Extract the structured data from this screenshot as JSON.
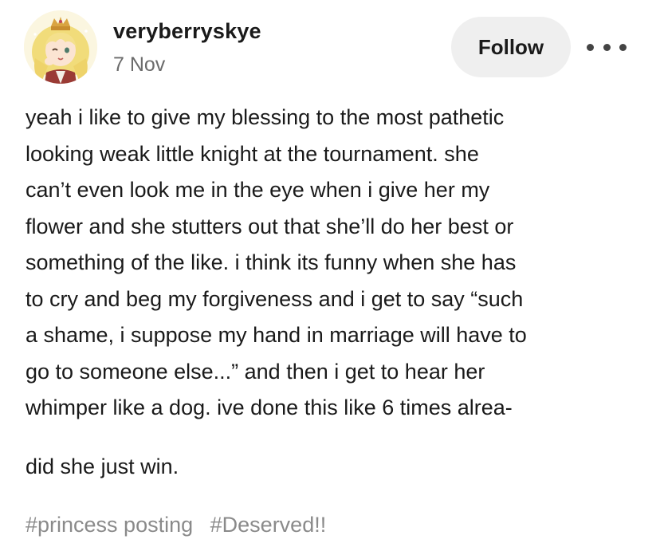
{
  "post": {
    "author": "veryberryskye",
    "date": "7 Nov",
    "follow_label": "Follow",
    "more_icon": "more-dots-icon",
    "body_lines": [
      "yeah i like to give my blessing to the most pathetic",
      "looking weak little knight at the tournament. she",
      "can’t even look me in the eye when i give her my",
      "flower and she stutters out that she’ll do her best or",
      "something of the like. i think its funny when she has",
      "to cry and beg my forgiveness and i get to say “such",
      "a shame, i suppose my hand in marriage will have to",
      "go to someone else...” and then i get to hear her",
      "whimper like a dog. ive done this like 6 times alrea-"
    ],
    "followup": "did she just win.",
    "tags": [
      "#princess posting",
      "#Deserved!!"
    ]
  },
  "colors": {
    "text": "#1a1a1a",
    "muted": "#6b6b6b",
    "tag": "#8a8a8a",
    "follow_bg": "#efefef"
  }
}
